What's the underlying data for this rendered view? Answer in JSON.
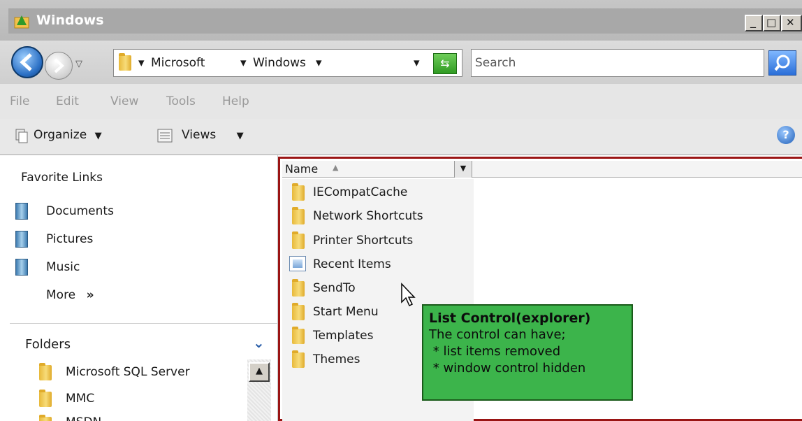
{
  "window": {
    "title": "Windows"
  },
  "title_buttons": {
    "minimize": "_",
    "maximize": "□",
    "close": "✕"
  },
  "address_bar": {
    "crumbs": [
      "Microsoft",
      "Windows"
    ]
  },
  "search": {
    "placeholder": "Search"
  },
  "menu": [
    "File",
    "Edit",
    "View",
    "Tools",
    "Help"
  ],
  "toolbar": {
    "organize": "Organize",
    "views": "Views"
  },
  "favorites": {
    "title": "Favorite Links",
    "items": [
      "Documents",
      "Pictures",
      "Music"
    ],
    "more": "More",
    "more_glyph": "»"
  },
  "folders": {
    "title": "Folders",
    "items": [
      "Microsoft SQL Server",
      "MMC",
      "MSDN"
    ]
  },
  "list": {
    "column_name": "Name",
    "items": [
      {
        "name": "IECompatCache",
        "icon": "folder-icon"
      },
      {
        "name": "Network Shortcuts",
        "icon": "folder-icon"
      },
      {
        "name": "Printer Shortcuts",
        "icon": "folder-icon"
      },
      {
        "name": "Recent Items",
        "icon": "shortcut-folder-icon"
      },
      {
        "name": "SendTo",
        "icon": "folder-icon"
      },
      {
        "name": "Start Menu",
        "icon": "folder-icon"
      },
      {
        "name": "Templates",
        "icon": "folder-icon"
      },
      {
        "name": "Themes",
        "icon": "folder-icon"
      }
    ]
  },
  "callout": {
    "title": "List Control(explorer)",
    "lines": [
      "The control can have;",
      " * list items removed",
      " * window control hidden"
    ]
  },
  "colors": {
    "callout_bg": "#3cb44b",
    "list_border": "#9a1414"
  }
}
